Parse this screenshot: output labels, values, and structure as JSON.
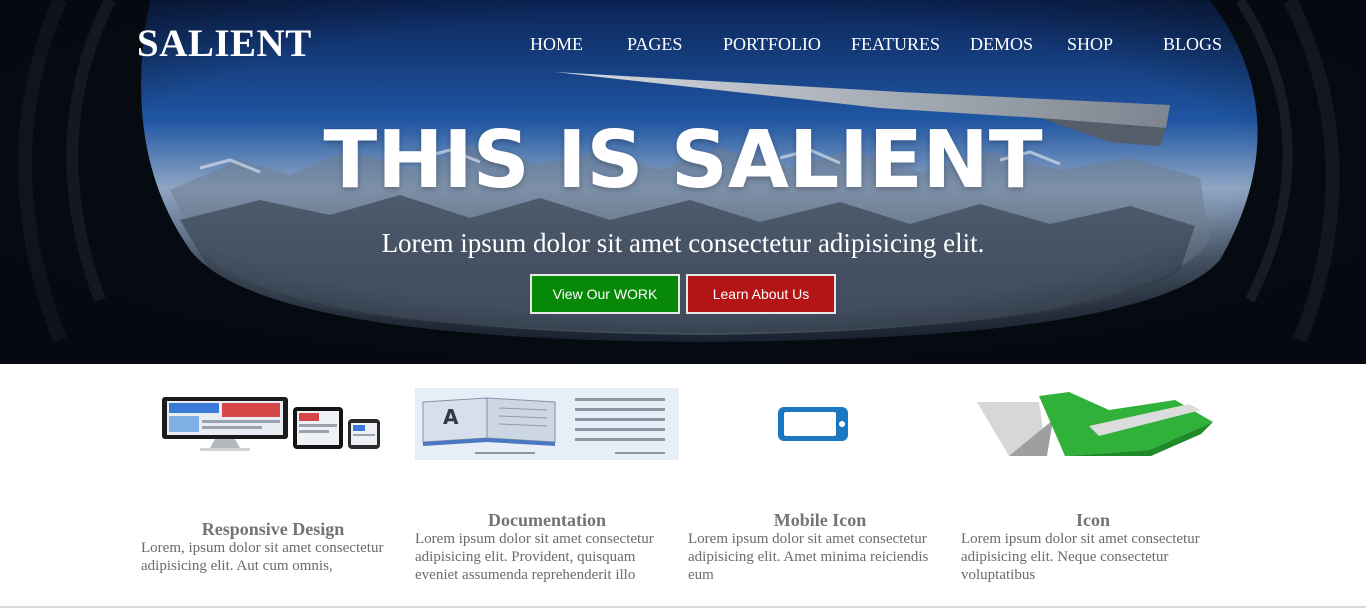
{
  "brand": "SALIENT",
  "nav": [
    "HOME",
    "PAGES",
    "PORTFOLIO",
    "FEATURES",
    "DEMOS",
    "SHOP",
    "BLOGS"
  ],
  "hero": {
    "title": "THIS IS SALIENT",
    "subtitle": "Lorem ipsum dolor sit amet consectetur adipisicing elit.",
    "primary_button": "View Our WORK",
    "secondary_button": "Learn About Us"
  },
  "colors": {
    "primary_button": "#078807",
    "secondary_button": "#b31515",
    "feature_text": "#6b6b6b"
  },
  "features": [
    {
      "icon": "responsive-devices-icon",
      "title": "Responsive Design",
      "text": "Lorem, ipsum dolor sit amet consectetur adipisicing elit. Aut cum omnis,"
    },
    {
      "icon": "open-book-icon",
      "title": "Documentation",
      "text": "Lorem ipsum dolor sit amet consectetur adipisicing elit. Provident, quisquam eveniet assumenda reprehenderit illo"
    },
    {
      "icon": "mobile-phone-icon",
      "title": "Mobile Icon",
      "text": "Lorem ipsum dolor sit amet consectetur adipisicing elit. Amet minima reiciendis eum"
    },
    {
      "icon": "checkmark-logo-icon",
      "title": "Icon",
      "text": "Lorem ipsum dolor sit amet consectetur adipisicing elit. Neque consectetur voluptatibus"
    }
  ]
}
